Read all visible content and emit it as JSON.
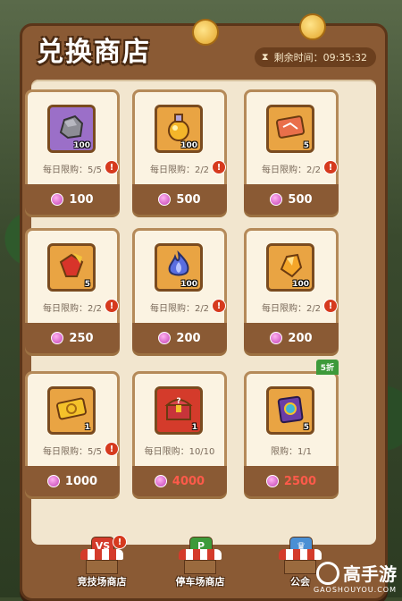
{
  "header": {
    "title": "兑换商店",
    "timer_label": "剩余时间：09:35:32"
  },
  "items": [
    {
      "name": "stone",
      "icon": "stone-icon",
      "bg": "#9b6fc8",
      "qty": "100",
      "limit": "每日限购：5/5",
      "price": "100",
      "price_red": false,
      "alert": "!"
    },
    {
      "name": "potion",
      "icon": "potion-icon",
      "bg": "#e9a443",
      "qty": "100",
      "limit": "每日限购：2/2",
      "price": "500",
      "price_red": false,
      "alert": "!"
    },
    {
      "name": "ticket-card",
      "icon": "ticket-card-icon",
      "bg": "#e9a443",
      "qty": "5",
      "limit": "每日限购：2/2",
      "price": "500",
      "price_red": false,
      "alert": "!"
    },
    {
      "name": "red-gem",
      "icon": "red-gem-icon",
      "bg": "#e9a443",
      "qty": "5",
      "limit": "每日限购：2/2",
      "price": "250",
      "price_red": false,
      "alert": "!"
    },
    {
      "name": "blue-flame",
      "icon": "blue-flame-icon",
      "bg": "#e9a443",
      "qty": "100",
      "limit": "每日限购：2/2",
      "price": "200",
      "price_red": false,
      "alert": "!"
    },
    {
      "name": "amber-crystal",
      "icon": "amber-crystal-icon",
      "bg": "#e9a443",
      "qty": "100",
      "limit": "每日限购：2/2",
      "price": "200",
      "price_red": false,
      "alert": "!"
    },
    {
      "name": "gold-ticket",
      "icon": "gold-ticket-icon",
      "bg": "#e9a443",
      "qty": "1",
      "limit": "每日限购：5/5",
      "price": "1000",
      "price_red": false,
      "alert": "!"
    },
    {
      "name": "treasure-chest",
      "icon": "treasure-chest-icon",
      "bg": "#d43b2b",
      "qty": "1",
      "limit": "每日限购：10/10",
      "price": "4000",
      "price_red": true,
      "alert": ""
    },
    {
      "name": "spell-book",
      "icon": "spell-book-icon",
      "bg": "#e9a443",
      "qty": "5",
      "limit": "限购：1/1",
      "price": "2500",
      "price_red": true,
      "alert": "",
      "discount": "5折"
    }
  ],
  "nav": [
    {
      "label": "竞技场商店",
      "sign": "VS",
      "sign_color": "#d43b2b",
      "alert": "!"
    },
    {
      "label": "停车场商店",
      "sign": "P",
      "sign_color": "#3d9a3a",
      "alert": ""
    },
    {
      "label": "公会",
      "sign": "♛",
      "sign_color": "#4a8fd4",
      "alert": ""
    }
  ],
  "watermark": {
    "brand": "高手游",
    "url": "GAOSHOUYOU.COM"
  }
}
